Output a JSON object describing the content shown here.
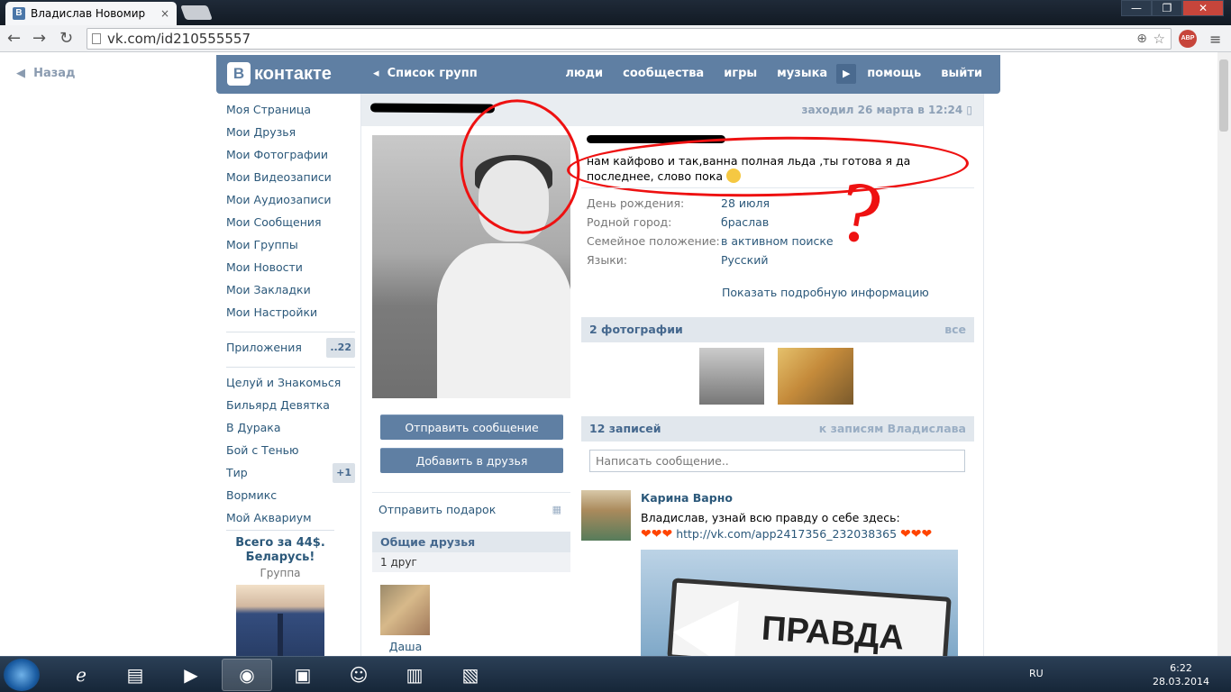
{
  "browser": {
    "tab_title": "Владислав Новомир",
    "tab_favicon": "В",
    "url": "vk.com/id210555557",
    "close_tab": "×",
    "abp_label": "ABP",
    "window_buttons": [
      "—",
      "❐",
      "✕"
    ]
  },
  "page": {
    "back": "Назад",
    "logo_letter": "В",
    "logo_text": "контакте",
    "groups_link": "Список групп",
    "topnav": [
      "люди",
      "сообщества",
      "игры",
      "музыка",
      "помощь",
      "выйти"
    ]
  },
  "left_menu": {
    "items": [
      "Моя Страница",
      "Мои Друзья",
      "Мои Фотографии",
      "Мои Видеозаписи",
      "Мои Аудиозаписи",
      "Мои Сообщения",
      "Мои Группы",
      "Мои Новости",
      "Мои Закладки",
      "Мои Настройки"
    ],
    "apps_label": "Приложения",
    "apps_count": "..22",
    "games": [
      "Целуй и Знакомься",
      "Бильярд Девятка",
      "В Дурака",
      "Бой с Тенью",
      "Тир",
      "Вормикс",
      "Мой Аквариум"
    ],
    "tir_count": "+1",
    "promo_title": "Всего за 44$. Беларусь!",
    "promo_sub": "Группа"
  },
  "profile": {
    "last_seen": "заходил 26 марта в 12:24",
    "status": "нам кайфово и так,ванна полная льда ,ты готова я да последнее, слово пока",
    "info": [
      {
        "label": "День рождения:",
        "value": "28 июля"
      },
      {
        "label": "Родной город:",
        "value": "браслав"
      },
      {
        "label": "Семейное положение:",
        "value": "в активном поиске"
      },
      {
        "label": "Языки:",
        "value": "Русский"
      }
    ],
    "more_info": "Показать подробную информацию",
    "send_message": "Отправить сообщение",
    "add_friend": "Добавить в друзья",
    "send_gift": "Отправить подарок",
    "common_friends_title": "Общие друзья",
    "common_friends_count": "1 друг",
    "friend_name": "Даша",
    "photos_title": "2 фотографии",
    "photos_all": "все",
    "wall_title": "12 записей",
    "wall_link": "к записям Владислава",
    "wall_placeholder": "Написать сообщение..",
    "post": {
      "author": "Карина Варно",
      "text": "Владислав, узнай всю правду о себе здесь:",
      "hearts_before": "❤❤❤",
      "link": "http://vk.com/app2417356_232038365",
      "hearts_after": "❤❤❤",
      "image_word": "ПРАВДА"
    }
  },
  "taskbar": {
    "lang": "RU",
    "time": "6:22",
    "date": "28.03.2014"
  },
  "colors": {
    "vk_blue": "#5f7fa3",
    "link": "#2b587a",
    "scribble_red": "#e11111"
  }
}
